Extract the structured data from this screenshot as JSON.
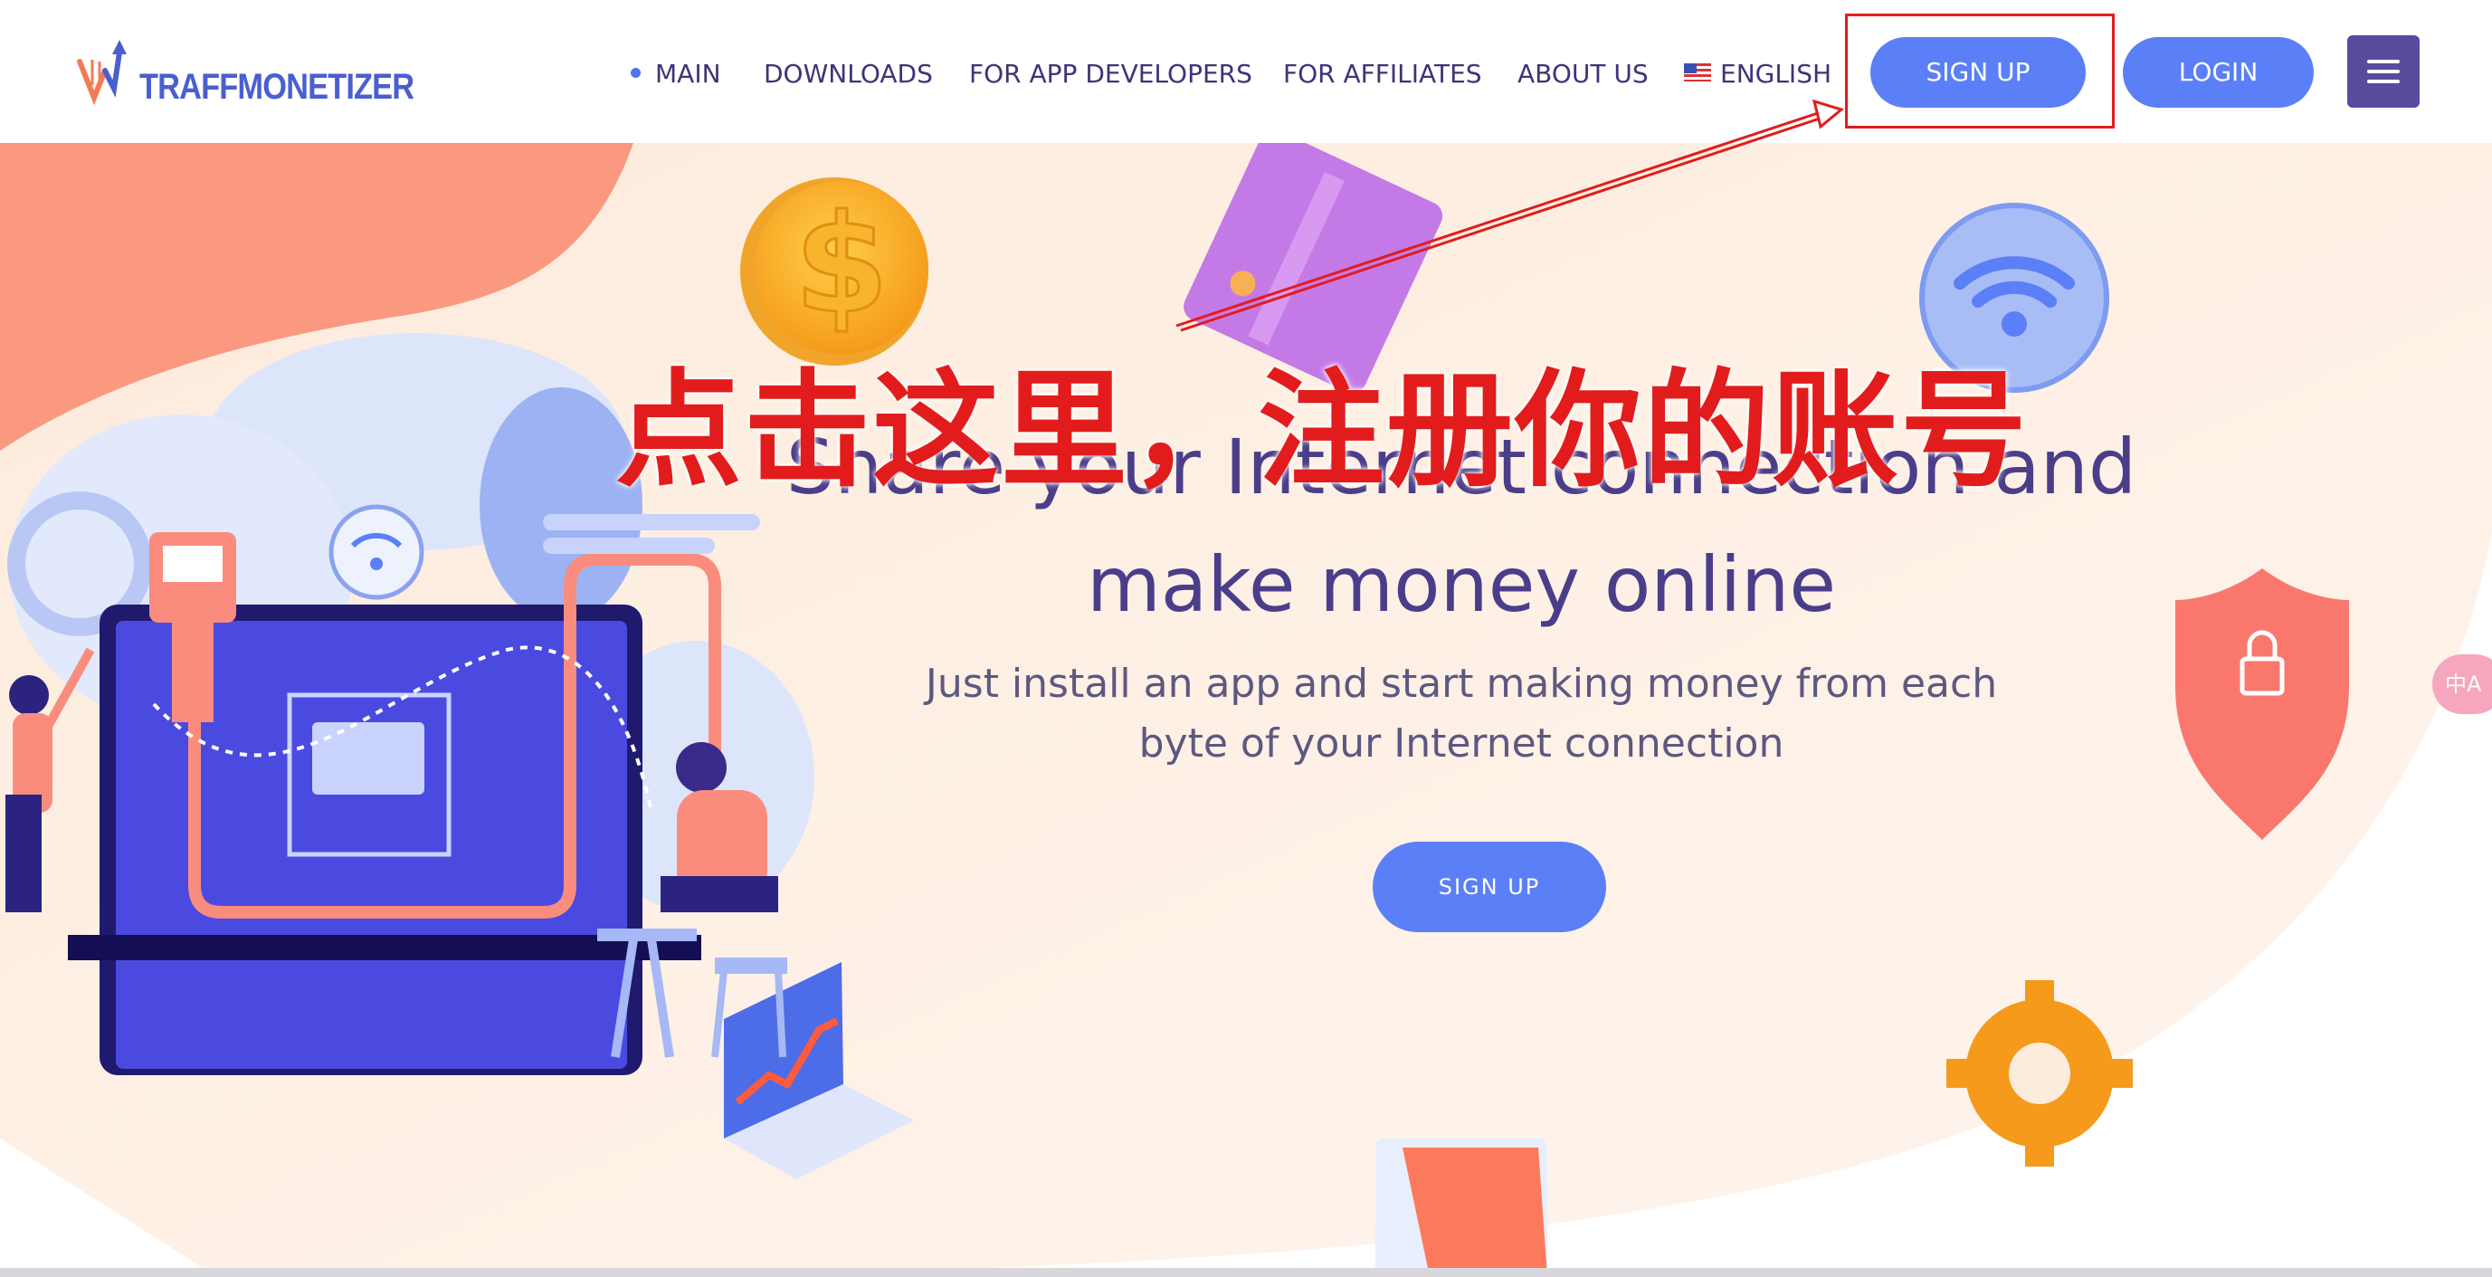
{
  "header": {
    "logo_text": "TRAFFMONETIZER",
    "nav": [
      {
        "label": "MAIN",
        "active": true
      },
      {
        "label": "DOWNLOADS"
      },
      {
        "label": "FOR APP DEVELOPERS"
      },
      {
        "label": "FOR AFFILIATES"
      },
      {
        "label": "ABOUT US"
      },
      {
        "label": "ENGLISH",
        "icon": "us-flag-icon"
      }
    ],
    "signup_label": "SIGN UP",
    "login_label": "LOGIN",
    "menu_icon": "hamburger-menu-icon"
  },
  "hero": {
    "headline_line1": "Share your Internet connection and",
    "headline_line2": "make money online",
    "subtext_line1": "Just install an app and start making money from each",
    "subtext_line2": "byte of your Internet connection",
    "signup_label": "SIGN UP"
  },
  "annotation": {
    "text": "点击这里，注册你的账号",
    "color": "#e21c1c"
  },
  "translate_widget": {
    "label": "中A"
  },
  "colors": {
    "brand_blue": "#5b7ff7",
    "nav_text": "#3e3476",
    "headline": "#4a3e8a",
    "menu_bg": "#5a4a9e",
    "hero_peach": "#fde9d9",
    "hero_salmon": "#fa9980"
  }
}
